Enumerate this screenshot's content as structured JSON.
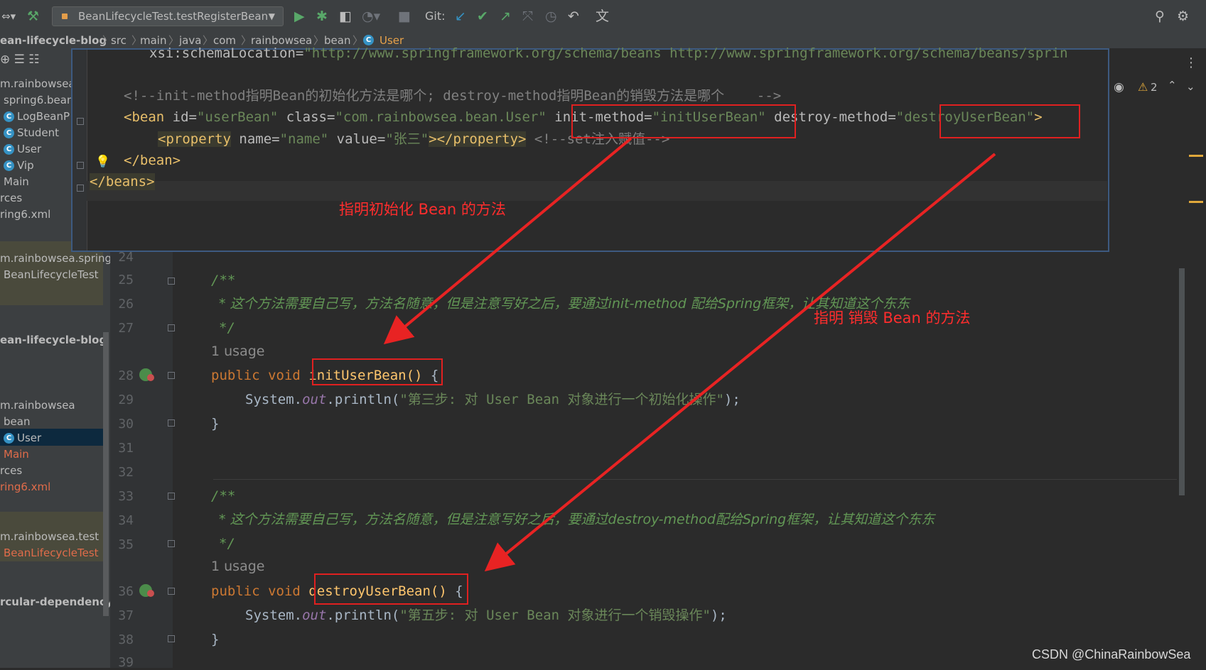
{
  "toolbar": {
    "run_config": "BeanLifecycleTest.testRegisterBean",
    "git_label": "Git:",
    "icons": [
      "hammer-icon",
      "run-icon",
      "debug-icon",
      "coverage-icon",
      "profile-icon",
      "stop-icon",
      "git-update-icon",
      "git-commit-icon",
      "git-push-icon",
      "git-history-icon",
      "rollback-icon",
      "translate-icon",
      "search-icon",
      "settings-icon"
    ]
  },
  "breadcrumb": [
    "ean-lifecycle-blog",
    "src",
    "main",
    "java",
    "com",
    "rainbowsea",
    "bean",
    "User"
  ],
  "project": {
    "items": [
      {
        "text": "m.rainbowsea",
        "class": false
      },
      {
        "text": "spring6.bean",
        "class": false
      },
      {
        "text": "LogBeanP",
        "class": true
      },
      {
        "text": "Student",
        "class": true
      },
      {
        "text": "User",
        "class": true
      },
      {
        "text": "Vip",
        "class": true
      },
      {
        "text": "Main",
        "class": false
      },
      {
        "text": "rces",
        "class": false
      },
      {
        "text": "ring6.xml",
        "class": false
      },
      {
        "text": "m.rainbowsea.spring6",
        "class": false
      },
      {
        "text": "BeanLifecycleTest",
        "class": false
      },
      {
        "text": "ean-lifecycle-blog",
        "class": false
      },
      {
        "text": "m.rainbowsea",
        "class": false
      },
      {
        "text": "bean",
        "class": false
      },
      {
        "text": "User",
        "class": true
      },
      {
        "text": "Main",
        "class": false
      },
      {
        "text": "rces",
        "class": false
      },
      {
        "text": "ring6.xml",
        "class": false
      },
      {
        "text": "m.rainbowsea.test",
        "class": false
      },
      {
        "text": "BeanLifecycleTest",
        "class": false
      },
      {
        "text": "rcular-dependency",
        "class": false
      }
    ]
  },
  "popup": {
    "line1_attr": "xsi:schemaLocation=",
    "line1_val": "\"http://www.springframework.org/schema/beans http://www.springframework.org/schema/beans/sprin",
    "line2": "<!--init-method指明Bean的初始化方法是哪个; destroy-method指明Bean的销毁方法是哪个    -->",
    "line3_open": "<bean",
    "line3_id_attr": " id=",
    "line3_id_val": "\"userBean\"",
    "line3_class_attr": " class=",
    "line3_class_val": "\"com.rainbowsea.bean.User\"",
    "line3_init_attr": " init-method=",
    "line3_init_val": "\"initUserBean\"",
    "line3_destroy_attr": " destroy-method=",
    "line3_destroy_val": "\"destroyUserBean\"",
    "line3_close": ">",
    "line4_prop": "<property",
    "line4_name_attr": " name=",
    "line4_name_val": "\"name\"",
    "line4_value_attr": " value=",
    "line4_value_val": "\"张三\"",
    "line4_close": "></property>",
    "line4_cmt": " <!--set注入赋值-->",
    "line5": "</bean>",
    "line6": "</beans>",
    "warning_count": "2"
  },
  "editor": {
    "lines": [
      "24",
      "25",
      "26",
      "27",
      "28",
      "29",
      "30",
      "31",
      "32",
      "33",
      "34",
      "35",
      "36",
      "37",
      "38",
      "39"
    ],
    "doc_open": "/**",
    "doc1": "* 这个方法需要自己写，方法名随意，但是注意写好之后，要通过init-method 配给Spring框架，让其知道这个东东",
    "doc_close": "*/",
    "usage": "1 usage",
    "kw_public": "public",
    "kw_void": "void",
    "init_name": "initUserBean()",
    "brace_open": "{",
    "brace_close": "}",
    "sys1_pre": "System.",
    "sys_out": "out",
    "sys_println": ".println(",
    "sys1_str": "\"第三步: 对 User Bean 对象进行一个初始化操作\"",
    "sys_end": ");",
    "doc2": "* 这个方法需要自己写，方法名随意，但是注意写好之后，要通过destroy-method配给Spring框架，让其知道这个东东",
    "destroy_name": "destroyUserBean()",
    "sys2_str": "\"第五步: 对 User Bean 对象进行一个销毁操作\""
  },
  "annotations": {
    "init_label": "指明初始化 Bean 的方法",
    "destroy_label": "指明 销毁 Bean 的方法",
    "color": "#e82323"
  },
  "watermark": "CSDN @ChinaRainbowSea"
}
